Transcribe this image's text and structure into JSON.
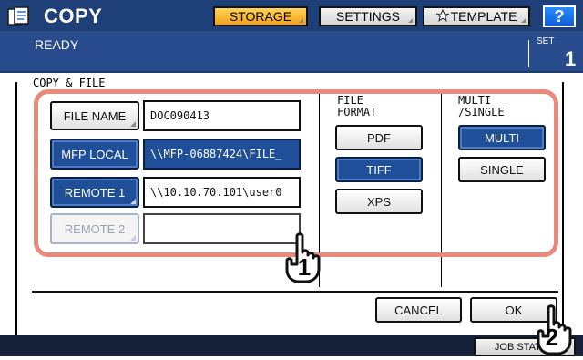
{
  "header": {
    "app_title": "COPY",
    "tabs": [
      {
        "label": "STORAGE",
        "active": true
      },
      {
        "label": "SETTINGS",
        "active": false
      },
      {
        "label": "TEMPLATE",
        "active": false,
        "icon": "star-icon"
      }
    ],
    "help_label": "?"
  },
  "status": {
    "text": "READY",
    "set_label": "SET",
    "set_count": "1"
  },
  "section": {
    "title": "COPY & FILE"
  },
  "destinations": [
    {
      "button_label": "FILE NAME",
      "value": "DOC090413",
      "state": "normal"
    },
    {
      "button_label": "MFP LOCAL",
      "value": "\\\\MFP-06887424\\FILE_",
      "state": "selected"
    },
    {
      "button_label": "REMOTE 1",
      "value": "\\\\10.10.70.101\\user0",
      "state": "selected"
    },
    {
      "button_label": "REMOTE 2",
      "value": "",
      "state": "disabled"
    }
  ],
  "file_format": {
    "heading_line1": "FILE",
    "heading_line2": "FORMAT",
    "options": [
      {
        "label": "PDF",
        "selected": false
      },
      {
        "label": "TIFF",
        "selected": true
      },
      {
        "label": "XPS",
        "selected": false
      }
    ]
  },
  "multi_single": {
    "heading_line1": "MULTI",
    "heading_line2": "/SINGLE",
    "options": [
      {
        "label": "MULTI",
        "selected": true
      },
      {
        "label": "SINGLE",
        "selected": false
      }
    ]
  },
  "footer": {
    "cancel_label": "CANCEL",
    "ok_label": "OK",
    "job_status_label": "JOB STATUS"
  },
  "callouts": {
    "first": "1",
    "second": "2"
  },
  "colors": {
    "header_bg": "#1e3f78",
    "status_bg": "#274b8c",
    "selected_bg": "#1f4f98",
    "active_tab": "#f2a019",
    "highlight": "#e88b7d"
  }
}
